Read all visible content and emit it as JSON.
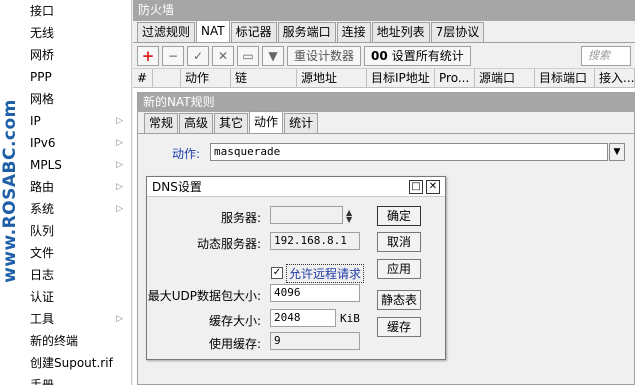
{
  "brand": {
    "text": "www.ROSABC.com"
  },
  "menu": {
    "items": [
      {
        "label": "接口",
        "arrow": ""
      },
      {
        "label": "无线",
        "arrow": ""
      },
      {
        "label": "网桥",
        "arrow": ""
      },
      {
        "label": "PPP",
        "arrow": ""
      },
      {
        "label": "网格",
        "arrow": ""
      },
      {
        "label": "IP",
        "arrow": "▷"
      },
      {
        "label": "IPv6",
        "arrow": "▷"
      },
      {
        "label": "MPLS",
        "arrow": "▷"
      },
      {
        "label": "路由",
        "arrow": "▷"
      },
      {
        "label": "系统",
        "arrow": "▷"
      },
      {
        "label": "队列",
        "arrow": ""
      },
      {
        "label": "文件",
        "arrow": ""
      },
      {
        "label": "日志",
        "arrow": ""
      },
      {
        "label": "认证",
        "arrow": ""
      },
      {
        "label": "工具",
        "arrow": "▷"
      },
      {
        "label": "新的终端",
        "arrow": ""
      },
      {
        "label": "创建Supout.rif",
        "arrow": ""
      },
      {
        "label": "手册",
        "arrow": ""
      }
    ]
  },
  "firewall": {
    "title": "防火墙",
    "tabs": [
      "过滤规则",
      "NAT",
      "标记器",
      "服务端口",
      "连接",
      "地址列表",
      "7层协议"
    ],
    "active_tab": "NAT",
    "toolbar": {
      "add": "+",
      "remove": "−",
      "enable": "✓",
      "disable": "✕",
      "comment": "▭",
      "filter": "▼",
      "reset_counters": "重设计数器",
      "reset_all_counters": "设置所有统计",
      "counter_prefix": "00",
      "search_placeholder": "搜索"
    },
    "columns": [
      "#",
      "动作",
      "链",
      "源地址",
      "目标IP地址",
      "Pro...",
      "源端口",
      "目标端口",
      "接入..."
    ]
  },
  "nat_rule": {
    "title": "新的NAT规则",
    "tabs": [
      "常规",
      "高级",
      "其它",
      "动作",
      "统计"
    ],
    "active_tab": "动作",
    "action_label": "动作:",
    "action_value": "masquerade"
  },
  "dns": {
    "title": "DNS设置",
    "servers_label": "服务器:",
    "servers_value": "",
    "dynamic_servers_label": "动态服务器:",
    "dynamic_servers_value": "192.168.8.1",
    "allow_remote_label": "允许远程请求",
    "allow_remote_checked": true,
    "max_udp_label": "最大UDP数据包大小:",
    "max_udp_value": "4096",
    "cache_size_label": "缓存大小:",
    "cache_size_value": "2048",
    "cache_size_unit": "KiB",
    "cache_used_label": "使用缓存:",
    "cache_used_value": "9",
    "buttons": {
      "ok": "确定",
      "cancel": "取消",
      "apply": "应用",
      "static": "静态表",
      "cache": "缓存"
    }
  }
}
